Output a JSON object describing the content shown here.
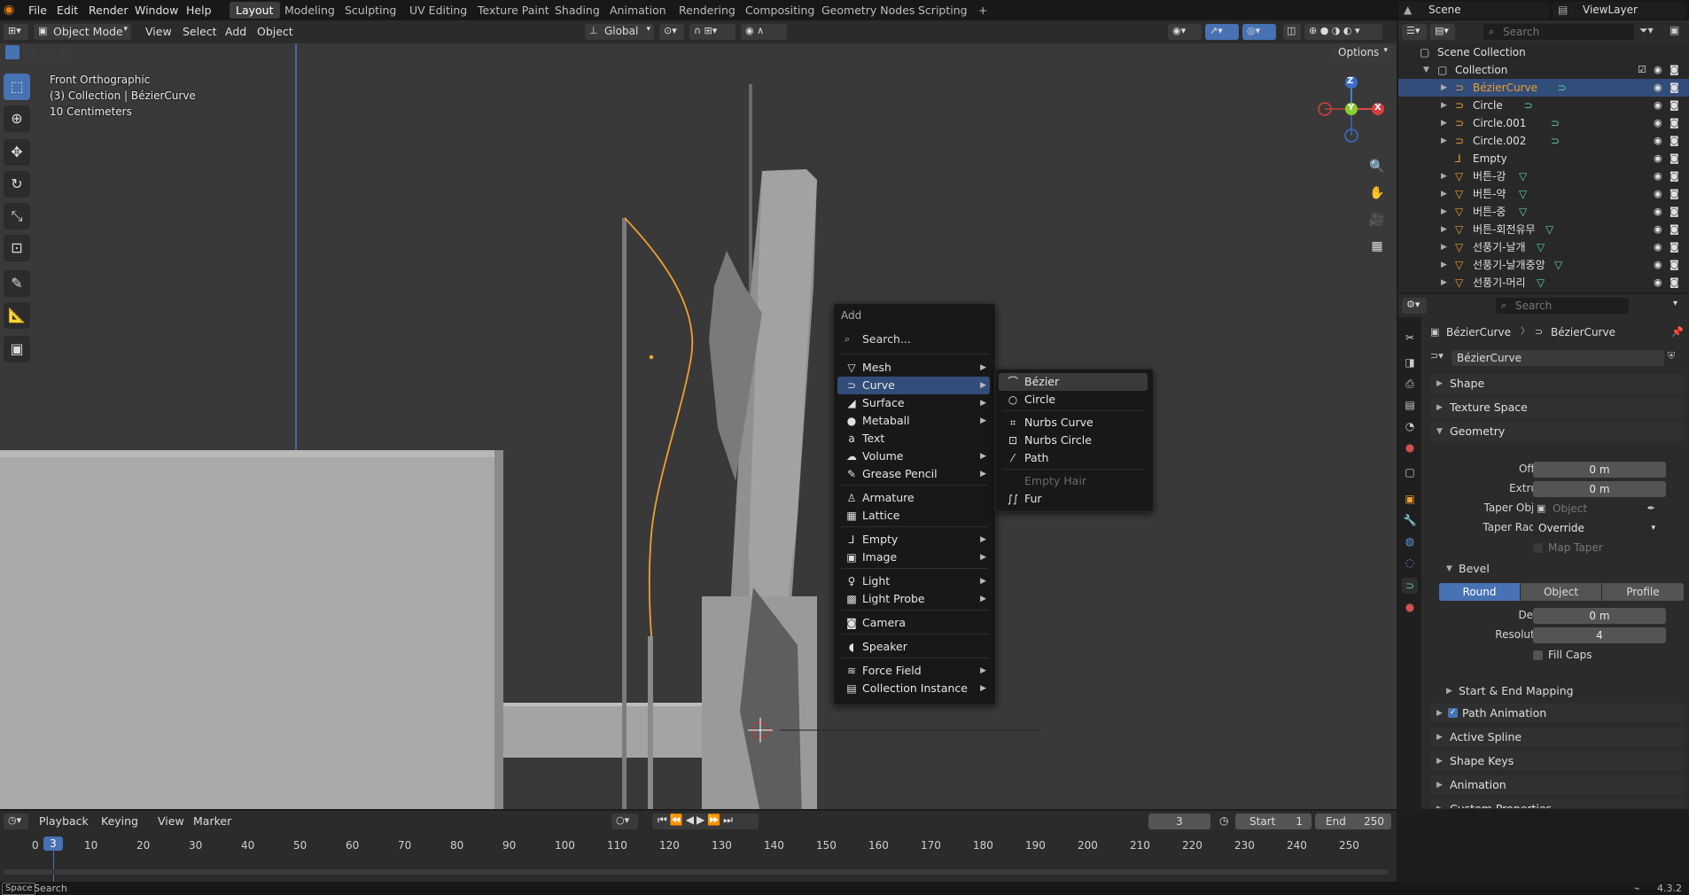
{
  "topbar": {
    "menus": [
      "File",
      "Edit",
      "Render",
      "Window",
      "Help"
    ],
    "workspaces": [
      "Layout",
      "Modeling",
      "Sculpting",
      "UV Editing",
      "Texture Paint",
      "Shading",
      "Animation",
      "Rendering",
      "Compositing",
      "Geometry Nodes",
      "Scripting"
    ],
    "active_workspace": "Layout",
    "add_workspace": "+",
    "scene": "Scene",
    "view_layer": "ViewLayer"
  },
  "viewport": {
    "mode": "Object Mode",
    "menus": [
      "View",
      "Select",
      "Add",
      "Object"
    ],
    "orientation": "Global",
    "options": "Options",
    "overlay_lines": [
      "Front Orthographic",
      "(3) Collection | BézierCurve",
      "10 Centimeters"
    ],
    "axes": {
      "x": "X",
      "y": "Y",
      "z": "Z"
    }
  },
  "add_menu": {
    "title": "Add",
    "search": "Search...",
    "items": [
      {
        "label": "Mesh",
        "icon": "mesh-icon",
        "glyph": "▽",
        "sub": true
      },
      {
        "label": "Curve",
        "icon": "curve-icon",
        "glyph": "⊃",
        "sub": true,
        "highlight": true
      },
      {
        "label": "Surface",
        "icon": "surface-icon",
        "glyph": "◢",
        "sub": true
      },
      {
        "label": "Metaball",
        "icon": "metaball-icon",
        "glyph": "●",
        "sub": true
      },
      {
        "label": "Text",
        "icon": "text-icon",
        "glyph": "a",
        "sub": false
      },
      {
        "label": "Volume",
        "icon": "volume-icon",
        "glyph": "☁",
        "sub": true
      },
      {
        "label": "Grease Pencil",
        "icon": "grease-pencil-icon",
        "glyph": "✎",
        "sub": true
      },
      {
        "label": "Armature",
        "icon": "armature-icon",
        "glyph": "♙",
        "sub": false
      },
      {
        "label": "Lattice",
        "icon": "lattice-icon",
        "glyph": "▦",
        "sub": false
      },
      {
        "label": "Empty",
        "icon": "empty-icon",
        "glyph": "⅃",
        "sub": true
      },
      {
        "label": "Image",
        "icon": "image-icon",
        "glyph": "▣",
        "sub": true
      },
      {
        "label": "Light",
        "icon": "light-icon",
        "glyph": "♀",
        "sub": true
      },
      {
        "label": "Light Probe",
        "icon": "light-probe-icon",
        "glyph": "▩",
        "sub": true
      },
      {
        "label": "Camera",
        "icon": "camera-icon",
        "glyph": "◙",
        "sub": false
      },
      {
        "label": "Speaker",
        "icon": "speaker-icon",
        "glyph": "◖",
        "sub": false
      },
      {
        "label": "Force Field",
        "icon": "force-field-icon",
        "glyph": "≋",
        "sub": true
      },
      {
        "label": "Collection Instance",
        "icon": "collection-instance-icon",
        "glyph": "▤",
        "sub": true
      }
    ]
  },
  "curve_submenu": {
    "items": [
      {
        "label": "Bézier",
        "icon": "bezier-icon",
        "glyph": "⌒",
        "highlight": true
      },
      {
        "label": "Circle",
        "icon": "circle-curve-icon",
        "glyph": "○"
      },
      {
        "label": "Nurbs Curve",
        "icon": "nurbs-curve-icon",
        "glyph": "⌗"
      },
      {
        "label": "Nurbs Circle",
        "icon": "nurbs-circle-icon",
        "glyph": "⊡"
      },
      {
        "label": "Path",
        "icon": "path-icon",
        "glyph": "⁄"
      },
      {
        "label": "Empty Hair",
        "icon": "empty-hair-icon",
        "glyph": "",
        "disabled": true
      },
      {
        "label": "Fur",
        "icon": "fur-icon",
        "glyph": "∫∫"
      }
    ]
  },
  "outliner": {
    "search_placeholder": "Search",
    "scene_collection": "Scene Collection",
    "collection": "Collection",
    "objects": [
      {
        "name": "BézierCurve",
        "type": "curve",
        "selected": true,
        "mod": true
      },
      {
        "name": "Circle",
        "type": "curve",
        "mod": true
      },
      {
        "name": "Circle.001",
        "type": "curve",
        "mod": true
      },
      {
        "name": "Circle.002",
        "type": "curve",
        "mod": true
      },
      {
        "name": "Empty",
        "type": "empty",
        "mod": false
      },
      {
        "name": "버튼-강",
        "type": "mesh",
        "mod": true
      },
      {
        "name": "버튼-약",
        "type": "mesh",
        "mod": true
      },
      {
        "name": "버튼-중",
        "type": "mesh",
        "mod": true
      },
      {
        "name": "버튼-회전유무",
        "type": "mesh",
        "mod": true
      },
      {
        "name": "선풍기-날개",
        "type": "mesh",
        "mod": true
      },
      {
        "name": "선풍기-날개중앙",
        "type": "mesh",
        "mod": true
      },
      {
        "name": "선풍기-머리",
        "type": "mesh",
        "mod": true
      }
    ]
  },
  "properties": {
    "search_placeholder": "Search",
    "breadcrumb": [
      "BézierCurve",
      "BézierCurve"
    ],
    "datablock": "BézierCurve",
    "panels_top": [
      "Shape",
      "Texture Space",
      "Geometry"
    ],
    "geometry": {
      "offset_label": "Offset",
      "offset": "0 m",
      "extrude_label": "Extrude",
      "extrude": "0 m",
      "taper_object_label": "Taper Object",
      "taper_object_placeholder": "Object",
      "taper_radius_label": "Taper Radius",
      "taper_radius": "Override",
      "map_taper": "Map Taper"
    },
    "bevel": {
      "title": "Bevel",
      "modes": [
        "Round",
        "Object",
        "Profile"
      ],
      "active": "Round",
      "depth_label": "Depth",
      "depth": "0 m",
      "resolution_label": "Resolution",
      "resolution": "4",
      "fill_caps": "Fill Caps"
    },
    "panels_bottom": [
      "Start & End Mapping",
      "Path Animation",
      "Active Spline",
      "Shape Keys",
      "Animation",
      "Custom Properties"
    ]
  },
  "timeline": {
    "menus": [
      "Playback",
      "Keying",
      "View",
      "Marker"
    ],
    "current_frame": "3",
    "start_label": "Start",
    "start": "1",
    "end_label": "End",
    "end": "250",
    "ticks": [
      "0",
      "10",
      "20",
      "30",
      "40",
      "50",
      "60",
      "70",
      "80",
      "90",
      "100",
      "110",
      "120",
      "130",
      "140",
      "150",
      "160",
      "170",
      "180",
      "190",
      "200",
      "210",
      "220",
      "230",
      "240",
      "250"
    ]
  },
  "statusbar": {
    "key": "Space",
    "action": "Search",
    "version": "4.3.2"
  },
  "colors": {
    "accent": "#4772b3",
    "selected_row": "#334d7a",
    "curve_orange": "#f0a030"
  }
}
